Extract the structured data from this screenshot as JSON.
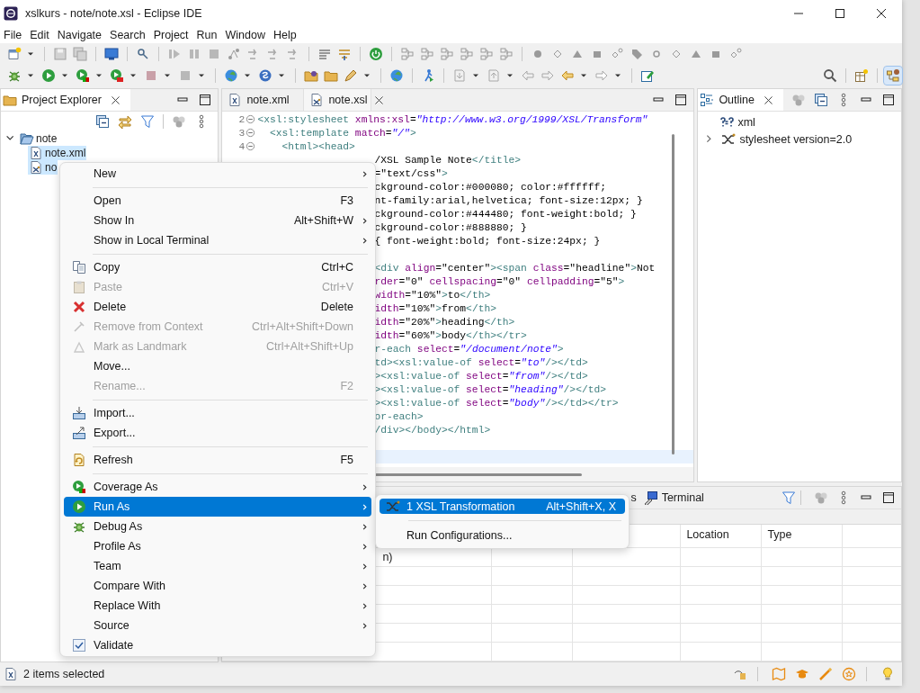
{
  "window": {
    "title": "xslkurs - note/note.xsl - Eclipse IDE"
  },
  "menu_bar": [
    "File",
    "Edit",
    "Navigate",
    "Search",
    "Project",
    "Run",
    "Window",
    "Help"
  ],
  "project_explorer": {
    "title": "Project Explorer",
    "tree": [
      {
        "label": "note",
        "expanded": true,
        "selected": false,
        "children": [
          {
            "label": "note.xml",
            "selected": true
          },
          {
            "label": "no",
            "selected": true
          }
        ]
      }
    ]
  },
  "editor": {
    "tabs": [
      {
        "label": "note.xml",
        "selected": false
      },
      {
        "label": "note.xsl",
        "selected": true
      }
    ],
    "lines": [
      {
        "kind": "code",
        "number": "2",
        "fold": true,
        "tokens": [
          {
            "kind": "tag",
            "text": "<xsl:stylesheet "
          },
          {
            "kind": "attr",
            "text": "xmlns:xsl"
          },
          {
            "kind": "text",
            "text": "="
          },
          {
            "kind": "string",
            "text": "\"http://www.w3.org/1999/XSL/Transform\""
          }
        ]
      },
      {
        "kind": "code",
        "number": "3",
        "fold": true,
        "tokens": [
          {
            "kind": "tag",
            "text": "  <xsl:template "
          },
          {
            "kind": "attr",
            "text": "match"
          },
          {
            "kind": "text",
            "text": "="
          },
          {
            "kind": "string",
            "text": "\"/\""
          },
          {
            "kind": "tag",
            "text": ">"
          }
        ]
      },
      {
        "kind": "code",
        "number": "4",
        "fold": true,
        "tokens": [
          {
            "kind": "tag",
            "text": "    <html><head>"
          }
        ]
      },
      {
        "kind": "code",
        "tokens": [
          {
            "kind": "text",
            "text": "/XSL Sample Note"
          },
          {
            "kind": "tag",
            "text": "</title>"
          }
        ]
      },
      {
        "kind": "code",
        "tokens": [
          {
            "kind": "text",
            "text": "=\"text/css\""
          },
          {
            "kind": "tag",
            "text": ">"
          }
        ]
      },
      {
        "kind": "code",
        "tokens": [
          {
            "kind": "text",
            "text": "ckground-color:#000080; color:#ffffff;"
          }
        ]
      },
      {
        "kind": "code",
        "tokens": [
          {
            "kind": "text",
            "text": "nt-family:arial,helvetica; font-size:12px; }"
          }
        ]
      },
      {
        "kind": "code",
        "tokens": [
          {
            "kind": "text",
            "text": "ckground-color:#444480; font-weight:bold; }"
          }
        ]
      },
      {
        "kind": "code",
        "tokens": [
          {
            "kind": "text",
            "text": "ckground-color:#888880; }"
          }
        ]
      },
      {
        "kind": "code",
        "tokens": [
          {
            "kind": "text",
            "text": "{ font-weight:bold; font-size:24px; }"
          }
        ]
      },
      {
        "kind": "blank"
      },
      {
        "kind": "code",
        "tokens": [
          {
            "kind": "tag",
            "text": "<div "
          },
          {
            "kind": "attr",
            "text": "align"
          },
          {
            "kind": "text",
            "text": "=\"center\""
          },
          {
            "kind": "tag",
            "text": "><span "
          },
          {
            "kind": "attr",
            "text": "class"
          },
          {
            "kind": "text",
            "text": "=\"headline\""
          },
          {
            "kind": "tag",
            "text": ">"
          },
          {
            "kind": "text",
            "text": "Not"
          }
        ]
      },
      {
        "kind": "code",
        "tokens": [
          {
            "kind": "attr",
            "text": "rder"
          },
          {
            "kind": "text",
            "text": "=\"0\" "
          },
          {
            "kind": "attr",
            "text": "cellspacing"
          },
          {
            "kind": "text",
            "text": "=\"0\" "
          },
          {
            "kind": "attr",
            "text": "cellpadding"
          },
          {
            "kind": "text",
            "text": "=\"5\""
          },
          {
            "kind": "tag",
            "text": ">"
          }
        ]
      },
      {
        "kind": "code",
        "tokens": [
          {
            "kind": "attr",
            "text": "width"
          },
          {
            "kind": "text",
            "text": "=\"10%\""
          },
          {
            "kind": "tag",
            "text": ">"
          },
          {
            "kind": "text",
            "text": "to"
          },
          {
            "kind": "tag",
            "text": "</th>"
          }
        ]
      },
      {
        "kind": "code",
        "tokens": [
          {
            "kind": "attr",
            "text": "idth"
          },
          {
            "kind": "text",
            "text": "=\"10%\""
          },
          {
            "kind": "tag",
            "text": ">"
          },
          {
            "kind": "text",
            "text": "from"
          },
          {
            "kind": "tag",
            "text": "</th>"
          }
        ]
      },
      {
        "kind": "code",
        "tokens": [
          {
            "kind": "attr",
            "text": "idth"
          },
          {
            "kind": "text",
            "text": "=\"20%\""
          },
          {
            "kind": "tag",
            "text": ">"
          },
          {
            "kind": "text",
            "text": "heading"
          },
          {
            "kind": "tag",
            "text": "</th>"
          }
        ]
      },
      {
        "kind": "code",
        "tokens": [
          {
            "kind": "attr",
            "text": "idth"
          },
          {
            "kind": "text",
            "text": "=\"60%\""
          },
          {
            "kind": "tag",
            "text": ">"
          },
          {
            "kind": "text",
            "text": "body"
          },
          {
            "kind": "tag",
            "text": "</th></tr>"
          }
        ]
      },
      {
        "kind": "code",
        "tokens": [
          {
            "kind": "tag",
            "text": "r-each "
          },
          {
            "kind": "attr",
            "text": "select"
          },
          {
            "kind": "text",
            "text": "="
          },
          {
            "kind": "string",
            "text": "\"/document/note\""
          },
          {
            "kind": "tag",
            "text": ">"
          }
        ]
      },
      {
        "kind": "code",
        "tokens": [
          {
            "kind": "tag",
            "text": "td><xsl:value-of "
          },
          {
            "kind": "attr",
            "text": "select"
          },
          {
            "kind": "text",
            "text": "="
          },
          {
            "kind": "string",
            "text": "\"to\""
          },
          {
            "kind": "tag",
            "text": "/></td>"
          }
        ]
      },
      {
        "kind": "code",
        "tokens": [
          {
            "kind": "tag",
            "text": "><xsl:value-of "
          },
          {
            "kind": "attr",
            "text": "select"
          },
          {
            "kind": "text",
            "text": "="
          },
          {
            "kind": "string",
            "text": "\"from\""
          },
          {
            "kind": "tag",
            "text": "/></td>"
          }
        ]
      },
      {
        "kind": "code",
        "tokens": [
          {
            "kind": "tag",
            "text": "><xsl:value-of "
          },
          {
            "kind": "attr",
            "text": "select"
          },
          {
            "kind": "text",
            "text": "="
          },
          {
            "kind": "string",
            "text": "\"heading\""
          },
          {
            "kind": "tag",
            "text": "/></td>"
          }
        ]
      },
      {
        "kind": "code",
        "tokens": [
          {
            "kind": "tag",
            "text": "><xsl:value-of "
          },
          {
            "kind": "attr",
            "text": "select"
          },
          {
            "kind": "text",
            "text": "="
          },
          {
            "kind": "string",
            "text": "\"body\""
          },
          {
            "kind": "tag",
            "text": "/></td></tr>"
          }
        ]
      },
      {
        "kind": "code",
        "tokens": [
          {
            "kind": "tag",
            "text": "or-each>"
          }
        ]
      },
      {
        "kind": "code",
        "tokens": [
          {
            "kind": "tag",
            "text": "/div></body></html>"
          }
        ]
      },
      {
        "kind": "blank"
      },
      {
        "kind": "blank",
        "current": true
      }
    ]
  },
  "outline": {
    "title": "Outline",
    "items": [
      {
        "label": "xml",
        "expandable": false
      },
      {
        "label": "stylesheet version=2.0",
        "expandable": true
      }
    ]
  },
  "bottom_panel": {
    "tabs": [
      {
        "label": "s",
        "selected": false
      },
      {
        "label": "Terminal",
        "selected": false
      }
    ],
    "columns": [
      "Location",
      "Type"
    ],
    "rows": [
      [
        "n)"
      ]
    ]
  },
  "context_menu": {
    "items": [
      {
        "kind": "item",
        "label": "New",
        "submenu": true,
        "disabled": false,
        "selected": false
      },
      {
        "kind": "separator"
      },
      {
        "kind": "item",
        "label": "Open",
        "shortcut": "F3",
        "submenu": false,
        "disabled": false,
        "selected": false
      },
      {
        "kind": "item",
        "label": "Show In",
        "shortcut": "Alt+Shift+W",
        "submenu": true,
        "disabled": false,
        "selected": false
      },
      {
        "kind": "item",
        "label": "Show in Local Terminal",
        "submenu": true,
        "disabled": false,
        "selected": false
      },
      {
        "kind": "separator"
      },
      {
        "kind": "item",
        "label": "Copy",
        "shortcut": "Ctrl+C",
        "submenu": false,
        "disabled": false,
        "selected": false
      },
      {
        "kind": "item",
        "label": "Paste",
        "shortcut": "Ctrl+V",
        "submenu": false,
        "disabled": true,
        "selected": false
      },
      {
        "kind": "item",
        "label": "Delete",
        "shortcut": "Delete",
        "submenu": false,
        "disabled": false,
        "selected": false
      },
      {
        "kind": "item",
        "label": "Remove from Context",
        "shortcut": "Ctrl+Alt+Shift+Down",
        "submenu": false,
        "disabled": true,
        "selected": false
      },
      {
        "kind": "item",
        "label": "Mark as Landmark",
        "shortcut": "Ctrl+Alt+Shift+Up",
        "submenu": false,
        "disabled": true,
        "selected": false
      },
      {
        "kind": "item",
        "label": "Move...",
        "submenu": false,
        "disabled": false,
        "selected": false
      },
      {
        "kind": "item",
        "label": "Rename...",
        "shortcut": "F2",
        "submenu": false,
        "disabled": true,
        "selected": false
      },
      {
        "kind": "separator"
      },
      {
        "kind": "item",
        "label": "Import...",
        "submenu": false,
        "disabled": false,
        "selected": false
      },
      {
        "kind": "item",
        "label": "Export...",
        "submenu": false,
        "disabled": false,
        "selected": false
      },
      {
        "kind": "separator"
      },
      {
        "kind": "item",
        "label": "Refresh",
        "shortcut": "F5",
        "submenu": false,
        "disabled": false,
        "selected": false
      },
      {
        "kind": "separator"
      },
      {
        "kind": "item",
        "label": "Coverage As",
        "submenu": true,
        "disabled": false,
        "selected": false
      },
      {
        "kind": "item",
        "label": "Run As",
        "submenu": true,
        "disabled": false,
        "selected": true
      },
      {
        "kind": "item",
        "label": "Debug As",
        "submenu": true,
        "disabled": false,
        "selected": false
      },
      {
        "kind": "item",
        "label": "Profile As",
        "submenu": true,
        "disabled": false,
        "selected": false
      },
      {
        "kind": "item",
        "label": "Team",
        "submenu": true,
        "disabled": false,
        "selected": false
      },
      {
        "kind": "item",
        "label": "Compare With",
        "submenu": true,
        "disabled": false,
        "selected": false
      },
      {
        "kind": "item",
        "label": "Replace With",
        "submenu": true,
        "disabled": false,
        "selected": false
      },
      {
        "kind": "item",
        "label": "Source",
        "submenu": true,
        "disabled": false,
        "selected": false
      },
      {
        "kind": "item",
        "label": "Validate",
        "submenu": false,
        "disabled": false,
        "selected": false
      }
    ]
  },
  "submenu": {
    "items": [
      {
        "kind": "item",
        "label": "1 XSL Transformation",
        "shortcut": "Alt+Shift+X, X",
        "selected": true
      },
      {
        "kind": "separator"
      },
      {
        "kind": "item",
        "label": "Run Configurations...",
        "selected": false
      }
    ]
  },
  "status_bar": {
    "text": "2 items selected"
  }
}
